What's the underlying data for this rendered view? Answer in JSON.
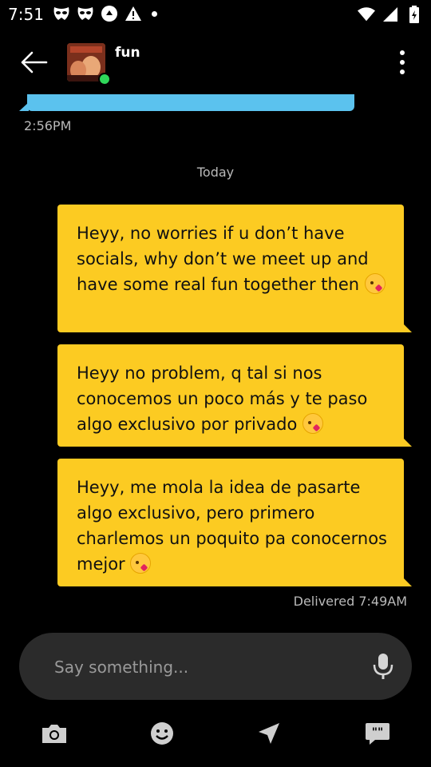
{
  "status_bar": {
    "time": "7:51",
    "left_icons": [
      "grindr-mask-icon",
      "grindr-mask-icon",
      "sync-icon",
      "warning-icon",
      "dot-icon"
    ],
    "right_icons": [
      "wifi-icon",
      "signal-icon",
      "battery-icon"
    ]
  },
  "header": {
    "chat_name": "fun",
    "online": true
  },
  "conversation": {
    "previous_time": "2:56PM",
    "day_separator": "Today",
    "messages": [
      {
        "text": "Heyy, no worries if u don’t have socials, why don’t we meet up and have some real fun together then",
        "emoji": "face-blowing-kiss"
      },
      {
        "text": "Heyy no problem, q tal si nos conocemos un poco más y te paso algo exclusivo por privado",
        "emoji": "face-blowing-kiss"
      },
      {
        "text": "Heyy, me mola la idea de pasarte algo exclusivo, pero primero charlemos un poquito pa conocernos mejor",
        "emoji": "face-blowing-kiss"
      }
    ],
    "delivered_label": "Delivered 7:49AM"
  },
  "composer": {
    "placeholder": "Say something..."
  },
  "toolbar": {
    "items": [
      "camera-icon",
      "emoji-icon",
      "send-location-icon",
      "saved-phrases-icon"
    ]
  },
  "colors": {
    "background": "#000000",
    "sent_bubble": "#fccb22",
    "received_bubble": "#5bc2ee",
    "composer": "#2b2b2b",
    "online": "#2fd75a"
  }
}
